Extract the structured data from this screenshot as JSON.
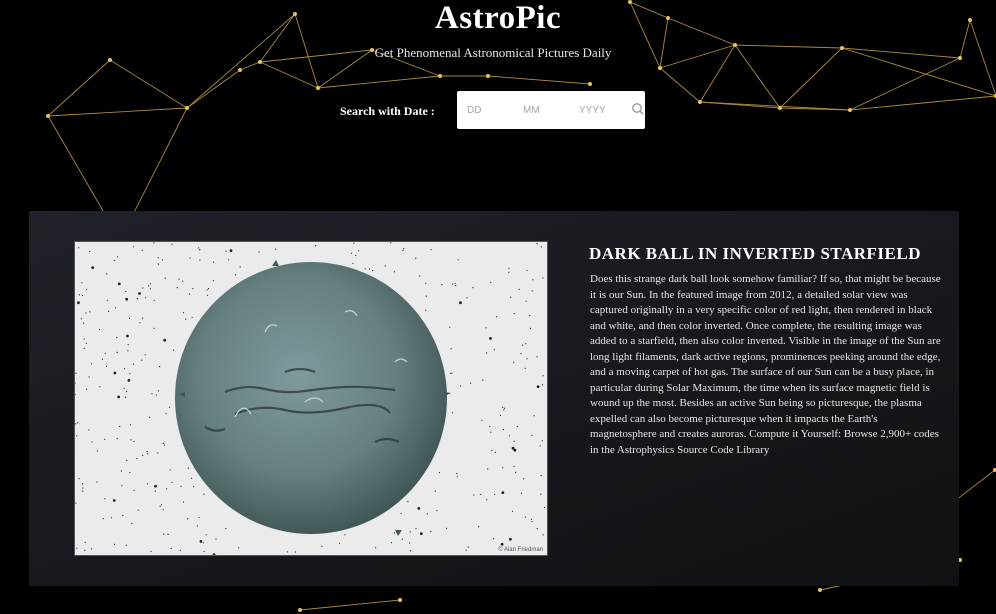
{
  "header": {
    "title": "AstroPic",
    "subtitle": "Get Phenomenal Astronomical Pictures Daily"
  },
  "search": {
    "label": "Search with Date :",
    "day_placeholder": "DD",
    "month_placeholder": "MM",
    "year_placeholder": "YYYY",
    "button_icon": "search-icon"
  },
  "apod": {
    "title": "DARK BALL IN INVERTED STARFIELD",
    "explanation": "Does this strange dark ball look somehow familiar? If so, that might be because it is our Sun. In the featured image from 2012, a detailed solar view was captured originally in a very specific color of red light, then rendered in black and white, and then color inverted. Once complete, the resulting image was added to a starfield, then also color inverted. Visible in the image of the Sun are long light filaments, dark active regions, prominences peeking around the edge, and a moving carpet of hot gas. The surface of our Sun can be a busy place, in particular during Solar Maximum, the time when its surface magnetic field is wound up the most. Besides an active Sun being so picturesque, the plasma expelled can also become picturesque when it impacts the Earth's magnetosphere and creates auroras. Compute it Yourself: Browse 2,900+ codes in the Astrophysics Source Code Library",
    "image_credit": "© Alan Friedman"
  },
  "colors": {
    "background": "#000000",
    "network_lines": "#c9a24a",
    "network_nodes": "#e8c25a",
    "card": "#1b1d22",
    "sun": "#5f7a7c"
  }
}
